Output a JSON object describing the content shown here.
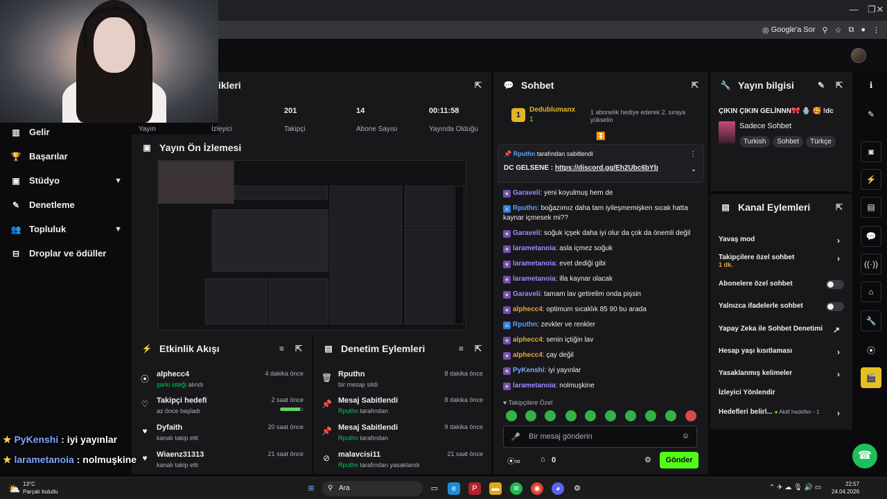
{
  "browser": {
    "google_sor": "Google'a Sor",
    "window_controls": [
      "—",
      "❐",
      "✕"
    ]
  },
  "nav": {
    "items": [
      {
        "label": "Gelir",
        "icon": "chart-icon"
      },
      {
        "label": "Başarılar",
        "icon": "trophy-icon"
      },
      {
        "label": "Stüdyo",
        "icon": "studio-icon"
      },
      {
        "label": "Denetleme",
        "icon": "wrench-icon"
      },
      {
        "label": "Topluluk",
        "icon": "people-icon"
      },
      {
        "label": "Droplar ve ödüller",
        "icon": "gift-icon"
      }
    ]
  },
  "stats": {
    "title": "ikleri",
    "items": [
      {
        "value": "",
        "label": "Yayın"
      },
      {
        "value": "",
        "label": "İzleyici"
      },
      {
        "value": "201",
        "label": "Takipçi"
      },
      {
        "value": "14",
        "label": "Abone Sayısı"
      },
      {
        "value": "00:11:58",
        "label": "Yayında Olduğu"
      }
    ]
  },
  "preview": {
    "title": "Yayın Ön İzlemesi"
  },
  "activity": {
    "title": "Etkinlik Akışı",
    "rows": [
      {
        "title": "alphecc4",
        "sub_hl": "şarkı isteği",
        "sub": " alındı",
        "time": "4 dakika önce",
        "icon": "song-request-icon"
      },
      {
        "title": "Takipçi hedefi",
        "sub": "az önce başladı",
        "time": "2 saat önce",
        "icon": "heart-outline-icon",
        "progress": 0.85
      },
      {
        "title": "Dyfaith",
        "sub": "kanalı takip etti",
        "time": "20 saat önce",
        "icon": "heart-icon"
      },
      {
        "title": "Wiaenz31313",
        "sub": "kanalı takip etti",
        "time": "21 saat önce",
        "icon": "heart-icon"
      }
    ]
  },
  "modlog": {
    "title": "Denetim Eylemleri",
    "rows": [
      {
        "title": "Rputhn",
        "sub": "bir mesajı sildi",
        "time": "8 dakika önce",
        "icon": "trash-icon"
      },
      {
        "title": "Mesaj Sabitlendi",
        "sub_hl": "Rputhn",
        "sub": " tarafından",
        "time": "8 dakika önce",
        "icon": "pin-icon"
      },
      {
        "title": "Mesaj Sabitlendi",
        "sub_hl": "Rputhn",
        "sub": " tarafından",
        "time": "9 dakika önce",
        "icon": "pin-icon"
      },
      {
        "title": "malavcisi11",
        "sub_hl": "Rputhn",
        "sub": " tarafından yasaklandı",
        "time": "21 saat önce",
        "icon": "ban-icon"
      }
    ]
  },
  "chat": {
    "title": "Sohbet",
    "top_gifter": {
      "rank": "1",
      "name": "Dedublumanx",
      "count": "1"
    },
    "gift_notice": "1 abonelik hediye ederek 2. sıraya yükselin",
    "pinned": {
      "by": "Rputhn",
      "by_suffix": " tarafından sabitlendi",
      "text_prefix": "DC GELSENE : ",
      "link": "https://discord.gg/Eh2Ubc6bYb"
    },
    "messages": [
      {
        "user": "Garaveli",
        "color": "#9b8cff",
        "text": "yeni koyulmuş hem de",
        "badge": "star"
      },
      {
        "user": "Rputhn",
        "color": "#5aa0ff",
        "text": "boğazımız daha tam iyileşmemişken sıcak hatta kaynar içmesek mi??",
        "badge": "mod"
      },
      {
        "user": "Garaveli",
        "color": "#9b8cff",
        "text": "soğuk içşek daha iyi olur da çok da önemli değil",
        "badge": "star"
      },
      {
        "user": "larametanoia",
        "color": "#9b8cff",
        "text": "asla içmez soğuk",
        "badge": "star"
      },
      {
        "user": "larametanoia",
        "color": "#9b8cff",
        "text": "evet dediği gibi",
        "badge": "star"
      },
      {
        "user": "larametanoia",
        "color": "#9b8cff",
        "text": "illa kaynar olacak",
        "badge": "star"
      },
      {
        "user": "Garaveli",
        "color": "#9b8cff",
        "text": "tamam lav getirelim onda pişsin",
        "badge": "star"
      },
      {
        "user": "alphecc4",
        "color": "#e2a93b",
        "text": "optimum sıcaklık 85 90 bu arada",
        "badge": "star"
      },
      {
        "user": "Rputhn",
        "color": "#5aa0ff",
        "text": "zevkler ve renkler",
        "badge": "mod"
      },
      {
        "user": "alphecc4",
        "color": "#e2a93b",
        "text": "senin içtiğin lav",
        "badge": "star"
      },
      {
        "user": "alphecc4",
        "color": "#e2a93b",
        "text": "çay değil",
        "badge": "star"
      },
      {
        "user": "PyKenshi",
        "color": "#7fa7ff",
        "text": "iyi yayınlar",
        "badge": "star"
      },
      {
        "user": "larametanoia",
        "color": "#9b8cff",
        "text": "nolmuşkine",
        "badge": "star"
      }
    ],
    "followers_only": "Takipçilere Özel",
    "input_placeholder": "Bir mesaj gönderin",
    "points": "0",
    "send": "Gönder"
  },
  "info": {
    "title": "Yayın bilgisi",
    "stream_title": "ÇIKIN ÇIKIN GELİNNN🎀 🪬 🥰 !dc",
    "category": "Sadece Sohbet",
    "tags": [
      "Turkish",
      "Sohbet",
      "Türkçe"
    ]
  },
  "actions": {
    "title": "Kanal Eylemleri",
    "items": [
      {
        "label": "Yavaş mod",
        "type": "arrow"
      },
      {
        "label": "Takipçilere özel sohbet",
        "sub": "1 dk.",
        "type": "arrow"
      },
      {
        "label": "Abonelere özel sohbet",
        "type": "toggle"
      },
      {
        "label": "Yalnızca ifadelerle sohbet",
        "type": "toggle"
      },
      {
        "label": "Yapay Zeka ile Sohbet Denetimi",
        "type": "external"
      },
      {
        "label": "Hesap yaşı kısıtlaması",
        "type": "arrow"
      },
      {
        "label": "Yasaklanmış kelimeler",
        "type": "arrow"
      },
      {
        "label": "İzleyici Yönlendir",
        "type": "none"
      },
      {
        "label": "Hedefleri belirl...",
        "sub": "Aktif hedefler - 1",
        "type": "arrow"
      }
    ]
  },
  "overlay": [
    {
      "user": "PyKenshi",
      "text": " : iyi yayınlar"
    },
    {
      "user": "larametanoia",
      "text": " : nolmuşkine"
    }
  ],
  "taskbar": {
    "weather_temp": "13°C",
    "weather_desc": "Parçalı bulutlu",
    "search": "Ara",
    "time": "22:57",
    "date": "24.04.2026"
  },
  "colors": {
    "accent": "#53fc18",
    "panel": "#18181b",
    "bg": "#0b0b0d"
  }
}
